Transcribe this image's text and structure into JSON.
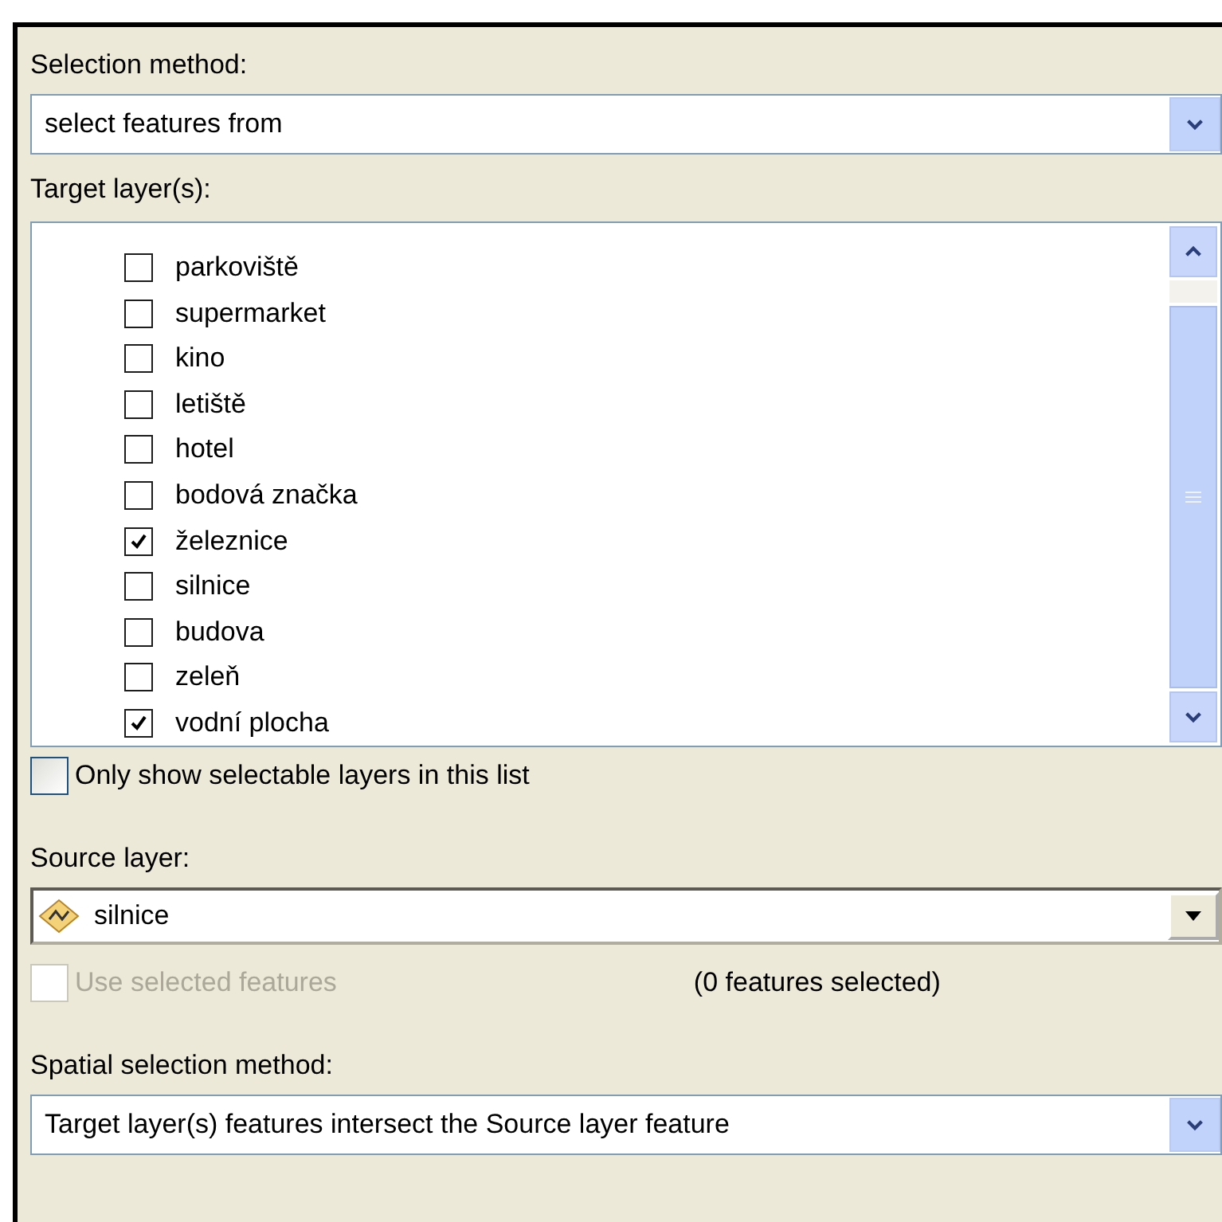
{
  "selection_method": {
    "label": "Selection method:",
    "value": "select features from"
  },
  "target_layers": {
    "label": "Target layer(s):",
    "items": [
      {
        "name": "parkoviště",
        "checked": false
      },
      {
        "name": "supermarket",
        "checked": false
      },
      {
        "name": "kino",
        "checked": false
      },
      {
        "name": "letiště",
        "checked": false
      },
      {
        "name": "hotel",
        "checked": false
      },
      {
        "name": "bodová značka",
        "checked": false
      },
      {
        "name": "železnice",
        "checked": true
      },
      {
        "name": "silnice",
        "checked": false
      },
      {
        "name": "budova",
        "checked": false
      },
      {
        "name": "zeleň",
        "checked": false
      },
      {
        "name": "vodní plocha",
        "checked": true
      }
    ]
  },
  "only_selectable": {
    "label": "Only show selectable layers in this list",
    "checked": false
  },
  "source_layer": {
    "label": "Source layer:",
    "value": "silnice"
  },
  "use_selected": {
    "label": "Use selected features",
    "checked": false,
    "disabled": true
  },
  "selection_count": "(0 features selected)",
  "spatial_method": {
    "label": "Spatial selection method:",
    "value": "Target layer(s) features intersect the Source layer feature"
  }
}
